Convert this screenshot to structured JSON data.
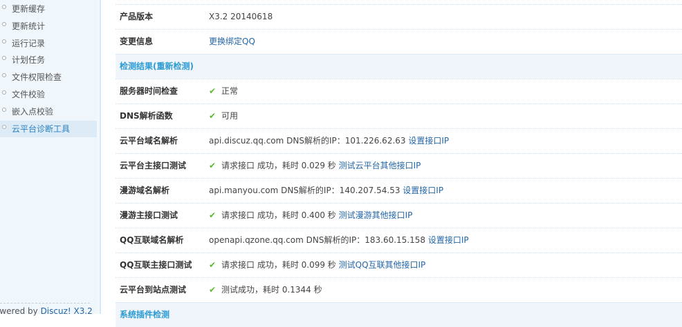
{
  "sidebar": {
    "items": [
      "更新缓存",
      "更新统计",
      "运行记录",
      "计划任务",
      "文件权限检查",
      "文件校验",
      "嵌入点校验",
      "云平台诊断工具"
    ],
    "active": 7,
    "footer_prefix": "owered by ",
    "footer_link": "Discuz! X3.2"
  },
  "info": [
    {
      "label": "产品版本",
      "value": "X3.2 20140618"
    },
    {
      "label": "变更信息",
      "link": "更换绑定QQ"
    }
  ],
  "section1": {
    "title": "检测结果",
    "link": "(重新检测)"
  },
  "rows": [
    {
      "label": "服务器时间检查",
      "check": true,
      "text": "正常"
    },
    {
      "label": "DNS解析函数",
      "check": true,
      "text": "可用"
    },
    {
      "label": "云平台域名解析",
      "check": false,
      "text": "api.discuz.qq.com DNS解析的IP：101.226.62.63 ",
      "link": "设置接口IP"
    },
    {
      "label": "云平台主接口测试",
      "check": true,
      "text": "请求接口 成功，耗时 0.029 秒 ",
      "link": "测试云平台其他接口IP"
    },
    {
      "label": "漫游域名解析",
      "check": false,
      "text": "api.manyou.com DNS解析的IP：140.207.54.53 ",
      "link": "设置接口IP"
    },
    {
      "label": "漫游主接口测试",
      "check": true,
      "text": "请求接口 成功，耗时 0.400 秒 ",
      "link": "测试漫游其他接口IP"
    },
    {
      "label": "QQ互联域名解析",
      "check": false,
      "text": "openapi.qzone.qq.com DNS解析的IP：183.60.15.158 ",
      "link": "设置接口IP"
    },
    {
      "label": "QQ互联主接口测试",
      "check": true,
      "text": "请求接口 成功，耗时 0.099 秒 ",
      "link": "测试QQ互联其他接口IP"
    },
    {
      "label": "云平台到站点测试",
      "check": true,
      "text": "测试成功，耗时 0.1344 秒"
    }
  ],
  "section2": {
    "title": "系统插件检测"
  }
}
